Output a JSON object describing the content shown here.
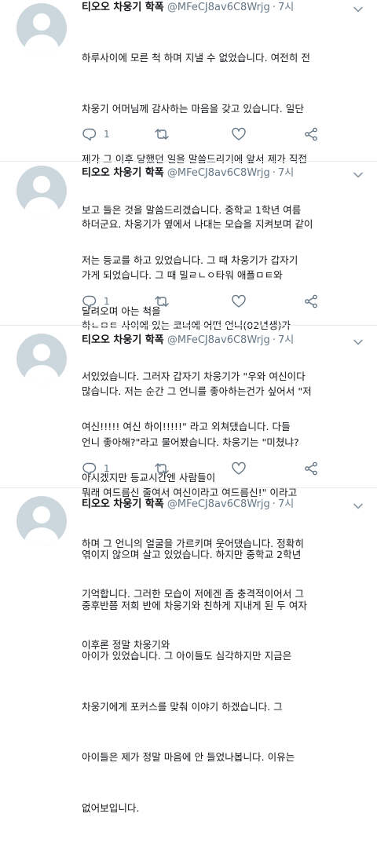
{
  "icons": {
    "reply": "reply-icon",
    "retweet": "retweet-icon",
    "like": "heart-icon",
    "share": "share-icon",
    "more": "chevron-down-icon",
    "avatar": "default-avatar-icon"
  },
  "colors": {
    "text": "#14171a",
    "secondary": "#657786",
    "divider": "#e6ecf0",
    "avatar_bg": "#ccd6dd"
  },
  "tweets": [
    {
      "author": "티오오 차웅기 학폭",
      "handle": "@MFeCJ8av6C8Wrjg",
      "dot": "·",
      "time": "7시",
      "lines": [
        "하루사이에 모른 척 하며 지낼 수 없었습니다. 여전히 전",
        "차웅기 어머님께 감사하는 마음을 갖고 있습니다. 일단",
        "제가 그 이후 당했던 일을 말씀드리기에 앞서 제가 직접",
        "보고 들은 것을 말씀드리겠습니다. 중학교 1학년 여름",
        "저는 등교를 하고 있었습니다. 그 때 차웅기가 갑자기",
        "달려오며 아는 척을"
      ],
      "reply_count": "1"
    },
    {
      "author": "티오오 차웅기 학폭",
      "handle": "@MFeCJ8av6C8Wrjg",
      "dot": "·",
      "time": "7시",
      "lines": [
        "하더군요. 차웅기가 옆에서 나대는 모습을 지켜보며 같이",
        "가게 되었습니다. 그 때 밀ㄹㄴㅇ타워 애플ㅁㅌ와",
        "하ㄴㅁㅌ 사이에 있는 코너에 어떤 언니(02년생)가",
        "서있었습니다. 그러자 갑자기 차웅기가 \"우와 여신이다",
        "여신!!!!! 여신 하이!!!!!\" 라고 외쳐댔습니다. 다들",
        "아시겠지만 등교시간엔 사람들이"
      ],
      "reply_count": "1"
    },
    {
      "author": "티오오 차웅기 학폭",
      "handle": "@MFeCJ8av6C8Wrjg",
      "dot": "·",
      "time": "7시",
      "lines": [
        "많습니다. 저는 순간 그 언니를 좋아하는건가 싶어서 \"저",
        "언니 좋아해?\"라고 물어봤습니다. 차웅기는 \"미쳤냐?",
        "뭐래 여드름신 줄여서 여신이라고 여드름신!\" 이라고",
        "하며 그 언니의 얼굴을 가르키며 웃어댔습니다. 정확히",
        "기억합니다. 그러한 모습이 저에겐 좀 충격적이어서 그",
        "이후론 정말 차웅기와"
      ],
      "reply_count": "1"
    },
    {
      "author": "티오오 차웅기 학폭",
      "handle": "@MFeCJ8av6C8Wrjg",
      "dot": "·",
      "time": "7시",
      "lines": [
        "엮이지 않으며 살고 있었습니다. 하지만 중학교 2학년",
        "중후반쯤 저희 반에 차웅기와 친하게 지내게 된 두 여자",
        "아이가 있었습니다. 그 아이들도 심각하지만 지금은",
        "차웅기에게 포커스를 맞춰 이야기 하겠습니다. 그",
        "아이들은 제가 정말 마음에 안 들었나봅니다. 이유는",
        "없어보입니다."
      ],
      "reply_count": ""
    }
  ]
}
